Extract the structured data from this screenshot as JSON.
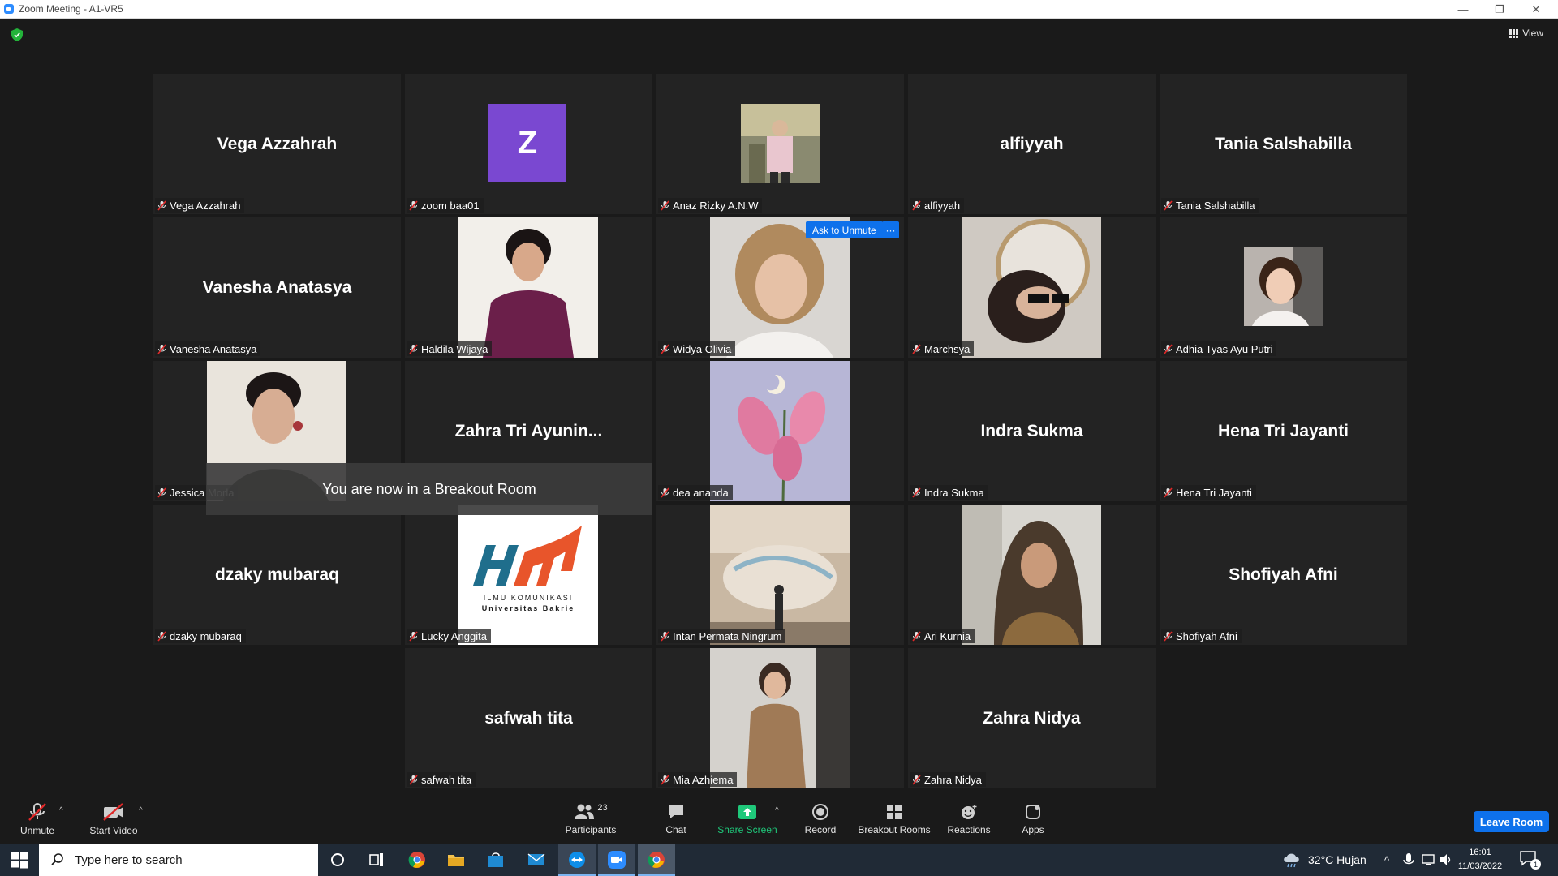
{
  "window": {
    "title": "Zoom Meeting - A1-VR5",
    "minimize": "—",
    "restore": "❐",
    "close": "✕"
  },
  "top": {
    "view_label": "View"
  },
  "tiles": [
    {
      "big": "Vega Azzahrah",
      "tag": "Vega Azzahrah"
    },
    {
      "big": "Z",
      "tag": "zoom baa01"
    },
    {
      "big": "",
      "tag": "Anaz Rizky A.N.W"
    },
    {
      "big": "alfiyyah",
      "tag": "alfiyyah"
    },
    {
      "big": "Tania Salshabilla",
      "tag": "Tania Salshabilla"
    },
    {
      "big": "Vanesha Anatasya",
      "tag": "Vanesha Anatasya"
    },
    {
      "big": "",
      "tag": "Haldila Wijaya"
    },
    {
      "big": "",
      "tag": "Widya Olivia"
    },
    {
      "big": "",
      "tag": "Marchsya"
    },
    {
      "big": "",
      "tag": "Adhia Tyas Ayu Putri"
    },
    {
      "big": "",
      "tag": "Jessica Morla"
    },
    {
      "big": "Zahra Tri Ayunin...",
      "tag": ""
    },
    {
      "big": "",
      "tag": "dea ananda"
    },
    {
      "big": "Indra Sukma",
      "tag": "Indra Sukma"
    },
    {
      "big": "Hena Tri Jayanti",
      "tag": "Hena Tri Jayanti"
    },
    {
      "big": "dzaky mubaraq",
      "tag": "dzaky mubaraq"
    },
    {
      "big": "",
      "tag": "Lucky Anggita"
    },
    {
      "big": "",
      "tag": "Intan Permata Ningrum"
    },
    {
      "big": "",
      "tag": "Ari Kurnia"
    },
    {
      "big": "Shofiyah Afni",
      "tag": "Shofiyah Afni"
    },
    {
      "big": "safwah tita",
      "tag": "safwah tita"
    },
    {
      "big": "",
      "tag": "Mia Azhiema"
    },
    {
      "big": "Zahra Nidya",
      "tag": "Zahra Nidya"
    }
  ],
  "hover_controls": {
    "ask_to_unmute": "Ask to Unmute",
    "more": "···"
  },
  "toast": "You are now in a Breakout Room",
  "logo_text": {
    "line1": "ILMU KOMUNIKASI",
    "line2": "Universitas Bakrie"
  },
  "toolbar": {
    "unmute": "Unmute",
    "start_video": "Start Video",
    "participants": "Participants",
    "participants_count": "23",
    "chat": "Chat",
    "share_screen": "Share Screen",
    "record": "Record",
    "breakout_rooms": "Breakout Rooms",
    "reactions": "Reactions",
    "apps": "Apps",
    "leave": "Leave Room"
  },
  "taskbar": {
    "search_placeholder": "Type here to search",
    "weather": "32°C  Hujan",
    "time": "16:01",
    "date": "11/03/2022",
    "notif_count": "1"
  },
  "colors": {
    "accent": "#0e71eb",
    "share_green": "#1fc87a",
    "muted_red": "#e02828",
    "z_avatar": "#7a48d1"
  }
}
